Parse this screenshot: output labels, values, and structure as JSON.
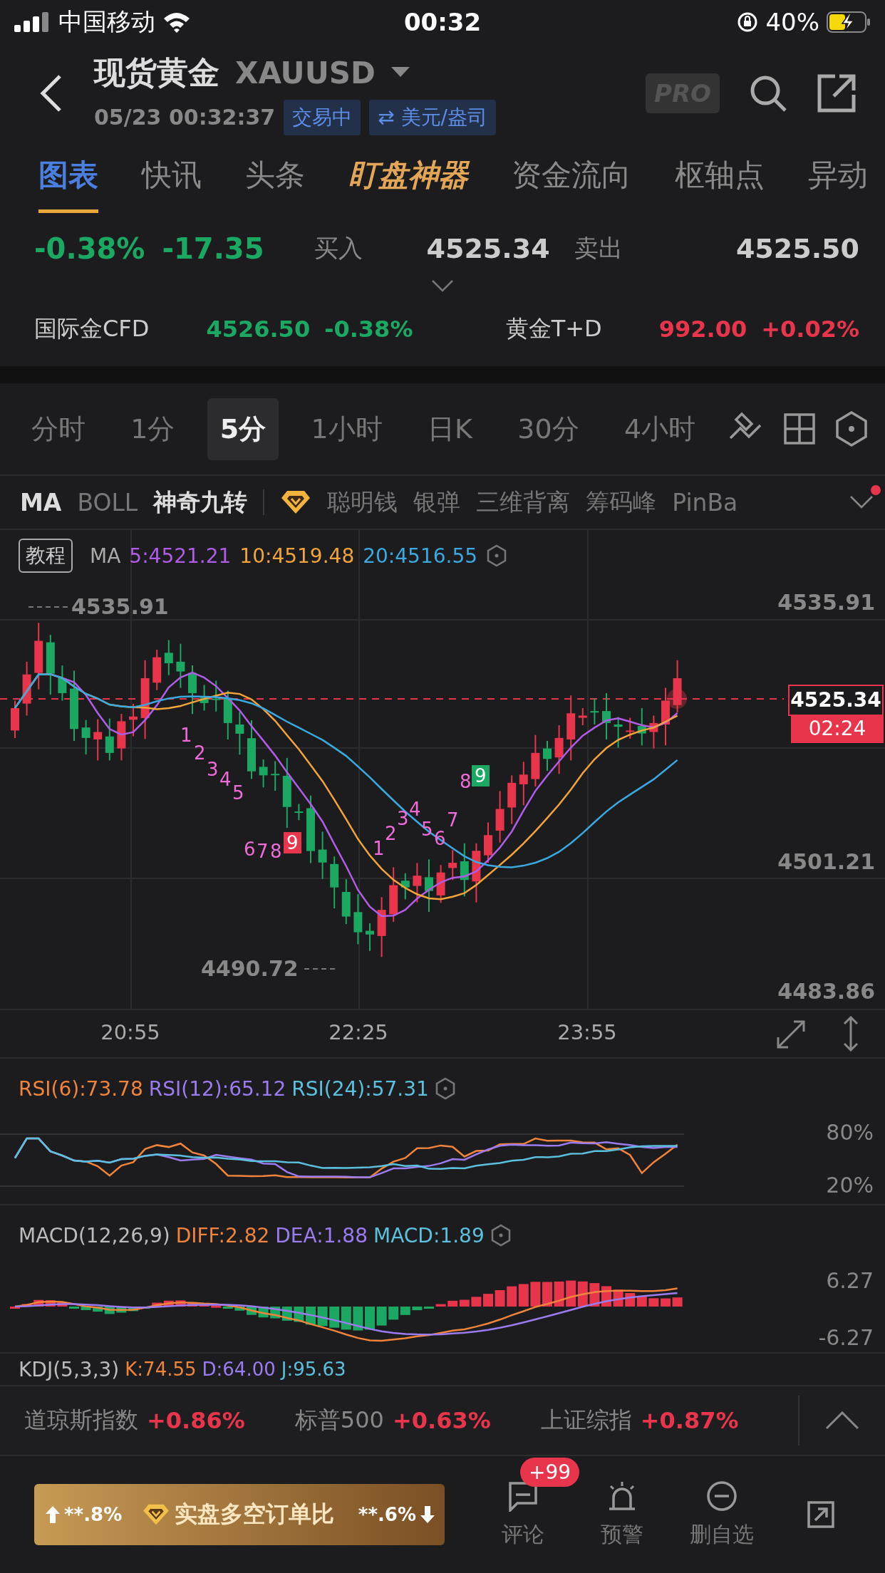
{
  "status_bar": {
    "carrier": "中国移动",
    "time": "00:32",
    "battery": "40%"
  },
  "header": {
    "title": "现货黄金",
    "symbol": "XAUUSD",
    "datetime": "05/23 00:32:37",
    "status_badge": "交易中",
    "unit_badge": "⇄ 美元/盎司",
    "pro_badge": "PRO"
  },
  "tabs": [
    {
      "label": "图表",
      "selected": true,
      "kind": "plain"
    },
    {
      "label": "快讯",
      "selected": false,
      "kind": "plain"
    },
    {
      "label": "头条",
      "selected": false,
      "kind": "plain"
    },
    {
      "label": "盯盘神器",
      "selected": false,
      "kind": "special"
    },
    {
      "label": "资金流向",
      "selected": false,
      "kind": "plain"
    },
    {
      "label": "枢轴点",
      "selected": false,
      "kind": "plain"
    },
    {
      "label": "异动",
      "selected": false,
      "kind": "plain"
    }
  ],
  "quote": {
    "change_pct": "-0.38%",
    "change": "-17.35",
    "rising": false,
    "bid_label": "买入",
    "bid": "4525.34",
    "ask_label": "卖出",
    "ask": "4525.50"
  },
  "related": [
    {
      "name": "国际金CFD",
      "price": "4526.50",
      "change": "-0.38%",
      "rising": false
    },
    {
      "name": "黄金T+D",
      "price": "992.00",
      "change": "+0.02%",
      "rising": true
    }
  ],
  "periods": [
    {
      "label": "分时",
      "selected": false
    },
    {
      "label": "1分",
      "selected": false
    },
    {
      "label": "5分",
      "selected": true
    },
    {
      "label": "1小时",
      "selected": false
    },
    {
      "label": "日K",
      "selected": false
    },
    {
      "label": "30分",
      "selected": false
    },
    {
      "label": "4小时",
      "selected": false
    }
  ],
  "main_indicators": [
    {
      "label": "MA",
      "selected": true
    },
    {
      "label": "BOLL",
      "selected": false
    },
    {
      "label": "神奇九转",
      "selected": true
    }
  ],
  "feature_indicators": [
    {
      "label": "聪明钱",
      "kind": "premium"
    },
    {
      "label": "银弹",
      "kind": "plain"
    },
    {
      "label": "三维背离",
      "kind": "plain"
    },
    {
      "label": "筹码峰",
      "kind": "plain"
    },
    {
      "label": "PinBa",
      "kind": "plain"
    }
  ],
  "more_badge": true,
  "chart": {
    "tutorial": "教程",
    "ma_label": "MA",
    "ma_values": [
      {
        "text": "5:4521.21",
        "color": "#b05ce6"
      },
      {
        "text": "10:4519.48",
        "color": "#f2a43a"
      },
      {
        "text": "20:4516.55",
        "color": "#3aa9e0"
      }
    ],
    "price_ticks": [
      "4535.91",
      "4501.21",
      "4483.86"
    ],
    "high_label": "4535.91",
    "low_label": "4490.72",
    "last_price": "4525.34",
    "countdown": "02:24",
    "time_ticks": [
      "20:55",
      "22:25",
      "23:55"
    ],
    "td_down": [
      "1",
      "2",
      "3",
      "4",
      "5",
      "6",
      "7",
      "8",
      "9"
    ],
    "td_up": [
      "1",
      "2",
      "3",
      "4",
      "5",
      "6",
      "7",
      "8",
      "9"
    ]
  },
  "rsi": {
    "values": [
      {
        "text": "RSI(6):73.78",
        "color": "#f0843c"
      },
      {
        "text": "RSI(12):65.12",
        "color": "#9b7cf0"
      },
      {
        "text": "RSI(24):57.31",
        "color": "#5bc0de"
      }
    ],
    "ticks": [
      "80%",
      "20%"
    ]
  },
  "macd": {
    "label": "MACD(12,26,9)",
    "values": [
      {
        "text": "DIFF:2.82",
        "color": "#f0843c"
      },
      {
        "text": "DEA:1.88",
        "color": "#9b7cf0"
      },
      {
        "text": "MACD:1.89",
        "color": "#5bc0de"
      }
    ],
    "ticks": [
      "6.27",
      "-6.27"
    ]
  },
  "kdj": {
    "label": "KDJ(5,3,3)",
    "values": [
      {
        "text": "K:74.55",
        "color": "#f0843c"
      },
      {
        "text": "D:64.00",
        "color": "#9b7cf0"
      },
      {
        "text": "J:95.63",
        "color": "#5bc0de"
      }
    ]
  },
  "indices": [
    {
      "name": "道琼斯指数",
      "change": "+0.86%",
      "rising": true
    },
    {
      "name": "标普500",
      "change": "+0.63%",
      "rising": true
    },
    {
      "name": "上证综指",
      "change": "+0.87%",
      "rising": true
    }
  ],
  "ratio_banner": {
    "long": "**.8%",
    "title": "实盘多空订单比",
    "short": "**.6%"
  },
  "actions": [
    {
      "kind": "comment",
      "label": "评论",
      "badge": "+99"
    },
    {
      "kind": "alert",
      "label": "预警"
    },
    {
      "kind": "remove",
      "label": "删自选"
    },
    {
      "kind": "share"
    }
  ]
}
